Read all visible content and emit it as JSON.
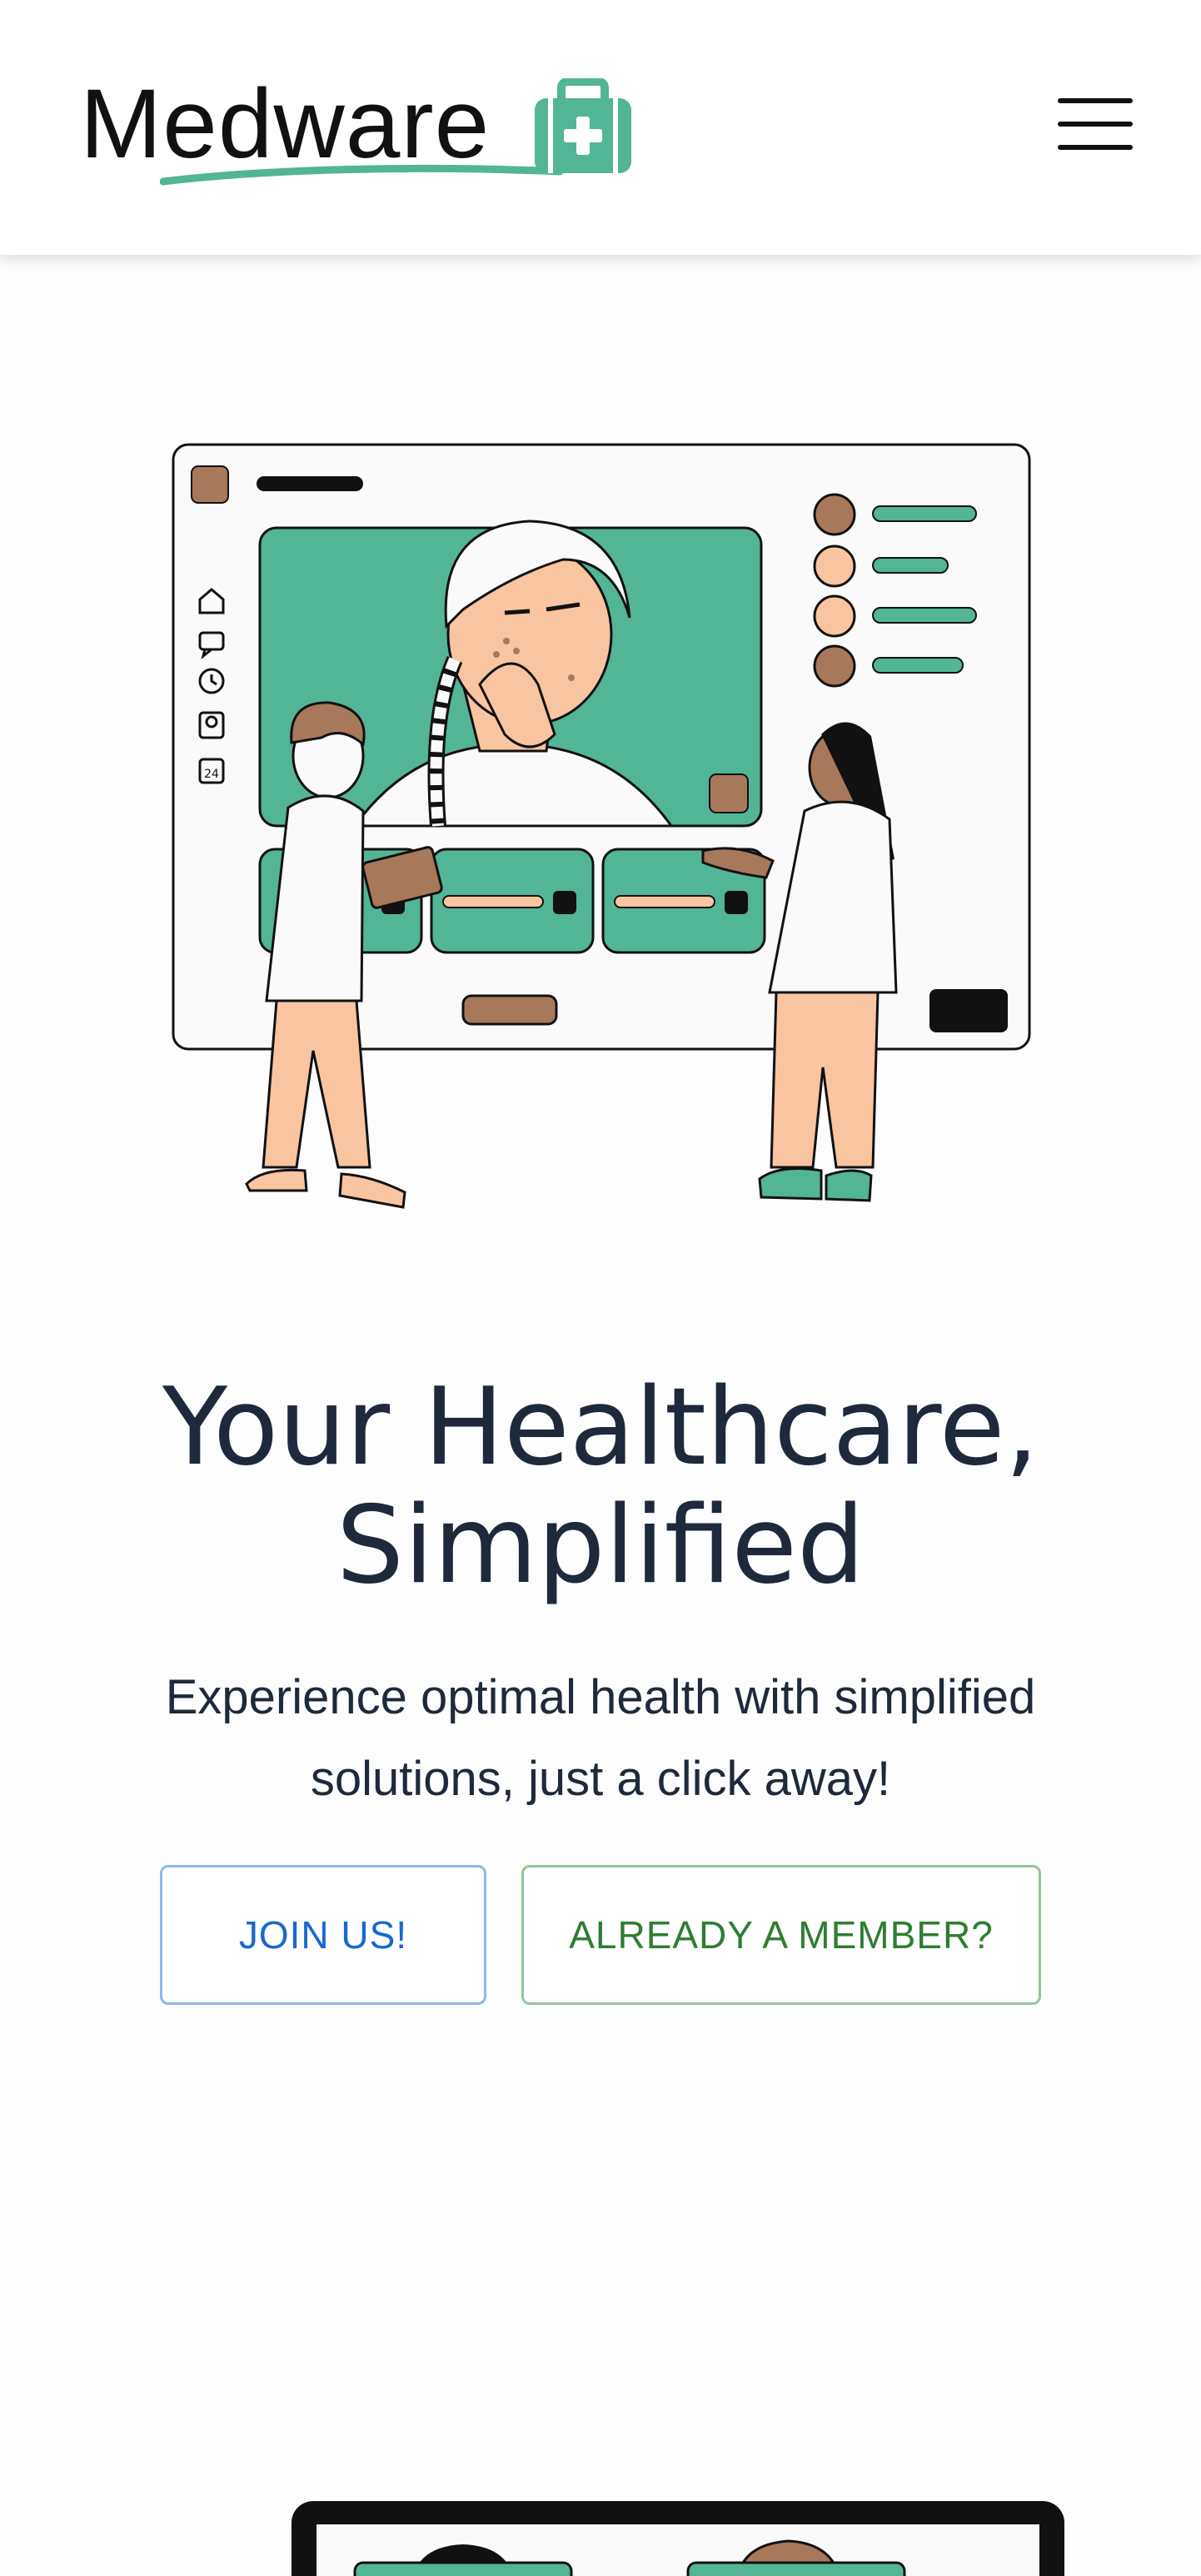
{
  "header": {
    "logo_text": "Medware",
    "logo_icon": "medical-kit-icon",
    "menu_icon": "hamburger-menu-icon"
  },
  "hero": {
    "title": "Your Healthcare, Simplified",
    "subtitle": "Experience optimal health with simplified solutions, just a click away!",
    "join_label": "JOIN US!",
    "member_label": "ALREADY A MEMBER?",
    "illustration": {
      "telehealth_screen_icons": [
        "home-icon",
        "chat-icon",
        "clock-icon",
        "contact-icon",
        "calendar-icon"
      ],
      "calendar_icon_text": "24"
    }
  },
  "colors": {
    "accent_green": "#52b596",
    "brown": "#a8785a",
    "skin": "#f9c4a0",
    "join_blue": "#1769cf",
    "member_green": "#2e7d32",
    "title": "#1e293b"
  }
}
